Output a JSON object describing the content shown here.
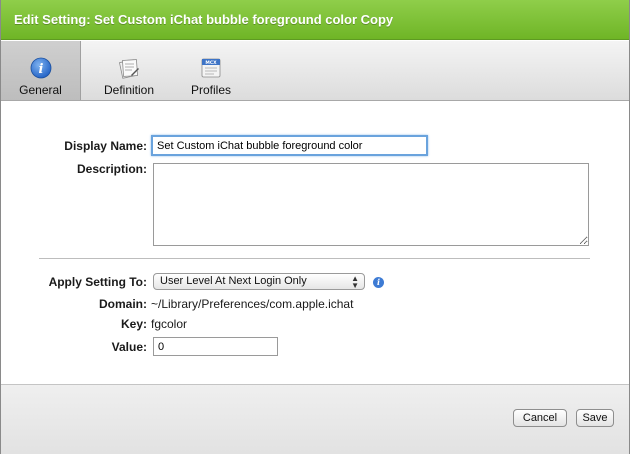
{
  "window": {
    "title": "Edit Setting: Set Custom iChat bubble foreground color Copy"
  },
  "tabs": [
    {
      "label": "General",
      "icon": "info-icon",
      "active": true
    },
    {
      "label": "Definition",
      "icon": "definition-icon",
      "active": false
    },
    {
      "label": "Profiles",
      "icon": "mcx-profile-icon",
      "active": false
    }
  ],
  "profiles_icon_text": "MCX",
  "form": {
    "display_name_label": "Display Name:",
    "display_name_value": "Set Custom iChat bubble foreground color",
    "description_label": "Description:",
    "description_value": "",
    "apply_label": "Apply Setting To:",
    "apply_value": "User Level At Next Login Only",
    "domain_label": "Domain:",
    "domain_value": "~/Library/Preferences/com.apple.ichat",
    "key_label": "Key:",
    "key_value": "fgcolor",
    "value_label": "Value:",
    "value_value": "0"
  },
  "buttons": {
    "cancel": "Cancel",
    "save": "Save"
  },
  "colors": {
    "titlebar": "#7cc036",
    "info_blue": "#3d7bd4",
    "focus_ring": "#6aa3dd"
  }
}
